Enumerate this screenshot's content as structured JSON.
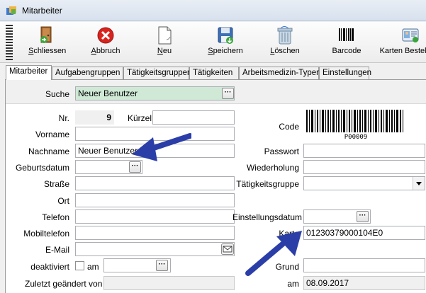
{
  "window": {
    "title": "Mitarbeiter"
  },
  "toolbar": [
    {
      "key": "schliessen",
      "label": "Schliessen",
      "icon": "exit-door-icon"
    },
    {
      "key": "abbruch",
      "label": "Abbruch",
      "icon": "cancel-x-icon"
    },
    {
      "key": "neu",
      "label": "Neu",
      "icon": "new-page-icon"
    },
    {
      "key": "speichern",
      "label": "Speichern",
      "icon": "floppy-save-icon"
    },
    {
      "key": "loeschen",
      "label": "Löschen",
      "icon": "trash-icon"
    },
    {
      "key": "barcode",
      "label": "Barcode",
      "icon": "barcode-icon"
    },
    {
      "key": "karten",
      "label": "Karten Bestellung",
      "icon": "id-card-icon"
    }
  ],
  "tabs": [
    "Mitarbeiter",
    "Aufgabengruppen",
    "Tätigkeitsgruppen",
    "Tätigkeiten",
    "Arbeitsmedizin-Typen",
    "Einstellungen"
  ],
  "form": {
    "suche_label": "Suche",
    "suche_value": "Neuer Benutzer",
    "nr_label": "Nr.",
    "nr_value": "9",
    "kuerzel_label": "Kürzel",
    "kuerzel_value": "",
    "vorname_label": "Vorname",
    "vorname_value": "",
    "nachname_label": "Nachname",
    "nachname_value": "Neuer Benutzer",
    "geburtsdatum_label": "Geburtsdatum",
    "strasse_label": "Straße",
    "ort_label": "Ort",
    "telefon_label": "Telefon",
    "mobiltelefon_label": "Mobiltelefon",
    "email_label": "E-Mail",
    "deaktiviert_label": "deaktiviert",
    "am_label": "am",
    "zuletzt_label": "Zuletzt geändert von",
    "code_label": "Code",
    "barcode_text": "P00009",
    "passwort_label": "Passwort",
    "wiederholung_label": "Wiederholung",
    "taetigkeitsgruppe_label": "Tätigkeitsgruppe",
    "einstellungsdatum_label": "Einstellungsdatum",
    "karte_label": "Karte",
    "karte_value": "01230379000104E0",
    "grund_label": "Grund",
    "am2_label": "am",
    "am2_value": "08.09.2017"
  },
  "colors": {
    "search_field": "#cfe9d6",
    "annotation_arrow": "#2b3ea8"
  }
}
